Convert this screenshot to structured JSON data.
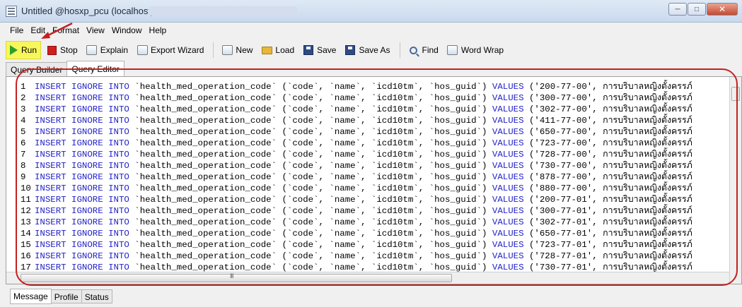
{
  "window": {
    "title": "Untitled @hosxp_pcu (localhost) *",
    "minimize": "─",
    "maximize": "□",
    "close": "✕"
  },
  "menu": {
    "file": "File",
    "edit": "Edit",
    "format": "Format",
    "view": "View",
    "window": "Window",
    "help": "Help"
  },
  "toolbar": {
    "run": "Run",
    "stop": "Stop",
    "explain": "Explain",
    "export_wizard": "Export Wizard",
    "new": "New",
    "load": "Load",
    "save": "Save",
    "save_as": "Save As",
    "find": "Find",
    "word_wrap": "Word Wrap"
  },
  "tabs": {
    "query_builder": "Query Builder",
    "query_editor": "Query Editor"
  },
  "editor": {
    "lines": [
      {
        "num": "1",
        "a": "INSERT IGNORE INTO ",
        "b": "`health_med_operation_code` (`code`, `name`, `icd10tm`, `hos_guid`) ",
        "c": "VALUES ",
        "d": "('200-77-00', ",
        "e": "การบริบาลหญิงตั้งครรภ์"
      },
      {
        "num": "2",
        "a": "INSERT IGNORE INTO ",
        "b": "`health_med_operation_code` (`code`, `name`, `icd10tm`, `hos_guid`) ",
        "c": "VALUES ",
        "d": "('300-77-00', ",
        "e": "การบริบาลหญิงตั้งครรภ์"
      },
      {
        "num": "3",
        "a": "INSERT IGNORE INTO ",
        "b": "`health_med_operation_code` (`code`, `name`, `icd10tm`, `hos_guid`) ",
        "c": "VALUES ",
        "d": "('302-77-00', ",
        "e": "การบริบาลหญิงตั้งครรภ์"
      },
      {
        "num": "4",
        "a": "INSERT IGNORE INTO ",
        "b": "`health_med_operation_code` (`code`, `name`, `icd10tm`, `hos_guid`) ",
        "c": "VALUES ",
        "d": "('411-77-00', ",
        "e": "การบริบาลหญิงตั้งครรภ์"
      },
      {
        "num": "5",
        "a": "INSERT IGNORE INTO ",
        "b": "`health_med_operation_code` (`code`, `name`, `icd10tm`, `hos_guid`) ",
        "c": "VALUES ",
        "d": "('650-77-00', ",
        "e": "การบริบาลหญิงตั้งครรภ์"
      },
      {
        "num": "6",
        "a": "INSERT IGNORE INTO ",
        "b": "`health_med_operation_code` (`code`, `name`, `icd10tm`, `hos_guid`) ",
        "c": "VALUES ",
        "d": "('723-77-00', ",
        "e": "การบริบาลหญิงตั้งครรภ์"
      },
      {
        "num": "7",
        "a": "INSERT IGNORE INTO ",
        "b": "`health_med_operation_code` (`code`, `name`, `icd10tm`, `hos_guid`) ",
        "c": "VALUES ",
        "d": "('728-77-00', ",
        "e": "การบริบาลหญิงตั้งครรภ์"
      },
      {
        "num": "8",
        "a": "INSERT IGNORE INTO ",
        "b": "`health_med_operation_code` (`code`, `name`, `icd10tm`, `hos_guid`) ",
        "c": "VALUES ",
        "d": "('730-77-00', ",
        "e": "การบริบาลหญิงตั้งครรภ์"
      },
      {
        "num": "9",
        "a": "INSERT IGNORE INTO ",
        "b": "`health_med_operation_code` (`code`, `name`, `icd10tm`, `hos_guid`) ",
        "c": "VALUES ",
        "d": "('878-77-00', ",
        "e": "การบริบาลหญิงตั้งครรภ์"
      },
      {
        "num": "10",
        "a": "INSERT IGNORE INTO ",
        "b": "`health_med_operation_code` (`code`, `name`, `icd10tm`, `hos_guid`) ",
        "c": "VALUES ",
        "d": "('880-77-00', ",
        "e": "การบริบาลหญิงตั้งครรภ์"
      },
      {
        "num": "11",
        "a": "INSERT IGNORE INTO ",
        "b": "`health_med_operation_code` (`code`, `name`, `icd10tm`, `hos_guid`) ",
        "c": "VALUES ",
        "d": "('200-77-01', ",
        "e": "การบริบาลหญิงตั้งครรภ์"
      },
      {
        "num": "12",
        "a": "INSERT IGNORE INTO ",
        "b": "`health_med_operation_code` (`code`, `name`, `icd10tm`, `hos_guid`) ",
        "c": "VALUES ",
        "d": "('300-77-01', ",
        "e": "การบริบาลหญิงตั้งครรภ์"
      },
      {
        "num": "13",
        "a": "INSERT IGNORE INTO ",
        "b": "`health_med_operation_code` (`code`, `name`, `icd10tm`, `hos_guid`) ",
        "c": "VALUES ",
        "d": "('302-77-01', ",
        "e": "การบริบาลหญิงตั้งครรภ์"
      },
      {
        "num": "14",
        "a": "INSERT IGNORE INTO ",
        "b": "`health_med_operation_code` (`code`, `name`, `icd10tm`, `hos_guid`) ",
        "c": "VALUES ",
        "d": "('650-77-01', ",
        "e": "การบริบาลหญิงตั้งครรภ์"
      },
      {
        "num": "15",
        "a": "INSERT IGNORE INTO ",
        "b": "`health_med_operation_code` (`code`, `name`, `icd10tm`, `hos_guid`) ",
        "c": "VALUES ",
        "d": "('723-77-01', ",
        "e": "การบริบาลหญิงตั้งครรภ์"
      },
      {
        "num": "16",
        "a": "INSERT IGNORE INTO ",
        "b": "`health_med_operation_code` (`code`, `name`, `icd10tm`, `hos_guid`) ",
        "c": "VALUES ",
        "d": "('728-77-01', ",
        "e": "การบริบาลหญิงตั้งครรภ์"
      },
      {
        "num": "17",
        "a": "INSERT IGNORE INTO ",
        "b": "`health_med_operation_code` (`code`, `name`, `icd10tm`, `hos_guid`) ",
        "c": "VALUES ",
        "d": "('730-77-01', ",
        "e": "การบริบาลหญิงตั้งครรภ์"
      }
    ],
    "hscroll_grip": "III"
  },
  "bottom_tabs": {
    "message": "Message",
    "profile": "Profile",
    "status": "Status"
  },
  "colors": {
    "keyword": "#2222c8",
    "run_highlight": "#f7f75b",
    "annotation_red": "#c42020"
  },
  "icons": {
    "app": "database-icon",
    "run": "play-icon",
    "stop": "stop-icon",
    "explain": "explain-icon",
    "export": "export-icon",
    "new": "new-icon",
    "load": "folder-icon",
    "save": "disk-icon",
    "save_as": "disk-icon",
    "find": "search-icon",
    "word_wrap": "word-wrap-icon"
  }
}
